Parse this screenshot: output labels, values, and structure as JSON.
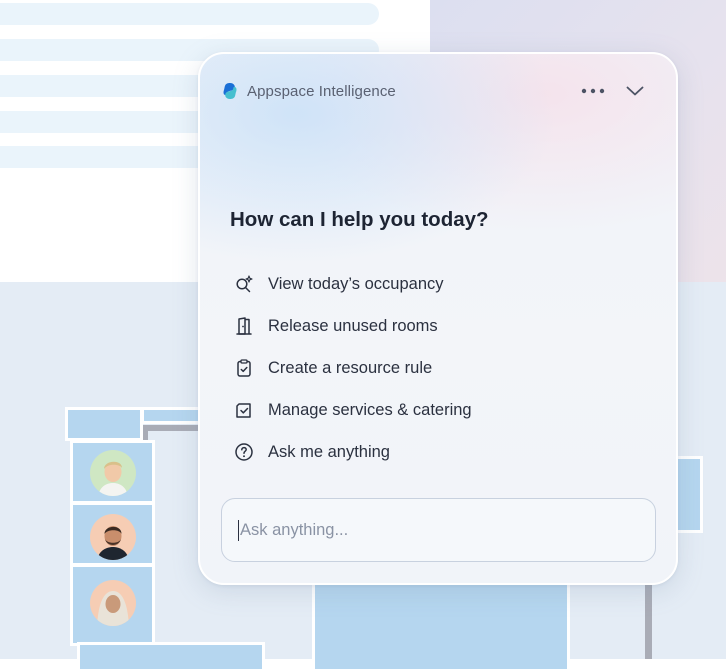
{
  "panel": {
    "title": "Appspace Intelligence",
    "logo_icon": "appspace-logo-icon",
    "more_icon": "more-horizontal-icon",
    "collapse_icon": "chevron-down-icon",
    "greeting": "How can I help you today?"
  },
  "suggestions": [
    {
      "label": "View today’s occupancy",
      "icon": "search-sparkle-icon"
    },
    {
      "label": "Release unused rooms",
      "icon": "door-icon"
    },
    {
      "label": "Create a resource rule",
      "icon": "clipboard-check-icon"
    },
    {
      "label": "Manage services & catering",
      "icon": "catering-box-icon"
    },
    {
      "label": "Ask me anything",
      "icon": "help-circle-icon"
    }
  ],
  "input": {
    "placeholder": "Ask anything...",
    "value": ""
  },
  "colors": {
    "room_fill": "#b5d6ef",
    "text_primary": "#1d2433",
    "text_secondary": "#5a6172",
    "logo_blue": "#1a6fd6",
    "logo_teal": "#46bfcf"
  }
}
